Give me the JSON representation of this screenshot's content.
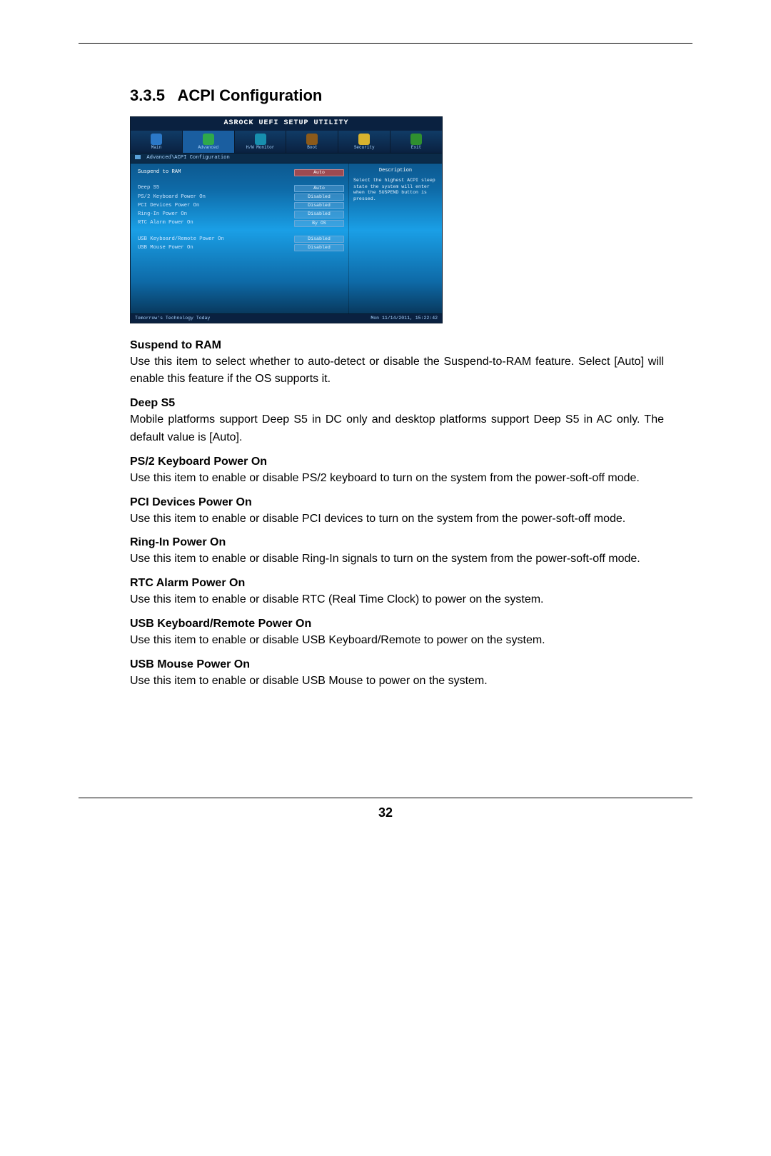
{
  "section_number": "3.3.5",
  "section_title": "ACPI Configuration",
  "page_number": "32",
  "bios": {
    "title": "ASROCK UEFI SETUP UTILITY",
    "tabs": [
      {
        "label": "Main"
      },
      {
        "label": "Advanced"
      },
      {
        "label": "H/W Monitor"
      },
      {
        "label": "Boot"
      },
      {
        "label": "Security"
      },
      {
        "label": "Exit"
      }
    ],
    "breadcrumb": "Advanced\\ACPI Configuration",
    "options": [
      {
        "label": "Suspend to RAM",
        "value": "Auto",
        "selected": true
      },
      {
        "label": "Deep S5",
        "value": "Auto"
      },
      {
        "label": "PS/2 Keyboard Power On",
        "value": "Disabled"
      },
      {
        "label": "PCI Devices Power On",
        "value": "Disabled"
      },
      {
        "label": "Ring-In Power On",
        "value": "Disabled"
      },
      {
        "label": "RTC Alarm Power On",
        "value": "By OS"
      }
    ],
    "options2": [
      {
        "label": "USB Keyboard/Remote Power On",
        "value": "Disabled"
      },
      {
        "label": "USB Mouse Power On",
        "value": "Disabled"
      }
    ],
    "description_title": "Description",
    "description_text": "Select the highest ACPI sleep state the system will enter when the SUSPEND button is pressed.",
    "footer_left": "Tomorrow's Technology Today",
    "footer_right": "Mon 11/14/2011, 15:22:42"
  },
  "entries": [
    {
      "title": "Suspend to RAM",
      "body": "Use this item to select whether to auto-detect or disable the Suspend-to-RAM feature. Select [Auto] will enable this feature if the OS supports it."
    },
    {
      "title": "Deep S5",
      "body": "Mobile platforms support Deep S5 in DC only and desktop platforms support Deep S5 in AC only. The default value is [Auto]."
    },
    {
      "title": "PS/2 Keyboard Power On",
      "body": "Use this item to enable or disable PS/2 keyboard to turn on the system from the power-soft-off mode."
    },
    {
      "title": "PCI Devices Power On",
      "body": "Use this item to enable or disable PCI devices to turn on the system from the power-soft-off mode."
    },
    {
      "title": "Ring-In Power On",
      "body": "Use this item to enable or disable Ring-In signals to turn on the system from the power-soft-off mode."
    },
    {
      "title": "RTC Alarm Power On",
      "body": "Use this item to enable or disable RTC (Real Time Clock) to power on the system."
    },
    {
      "title": "USB Keyboard/Remote Power On",
      "body": "Use this item to enable or disable USB Keyboard/Remote to power on the system."
    },
    {
      "title": "USB Mouse Power On",
      "body": "Use this item to enable or disable USB Mouse to power on the system."
    }
  ]
}
